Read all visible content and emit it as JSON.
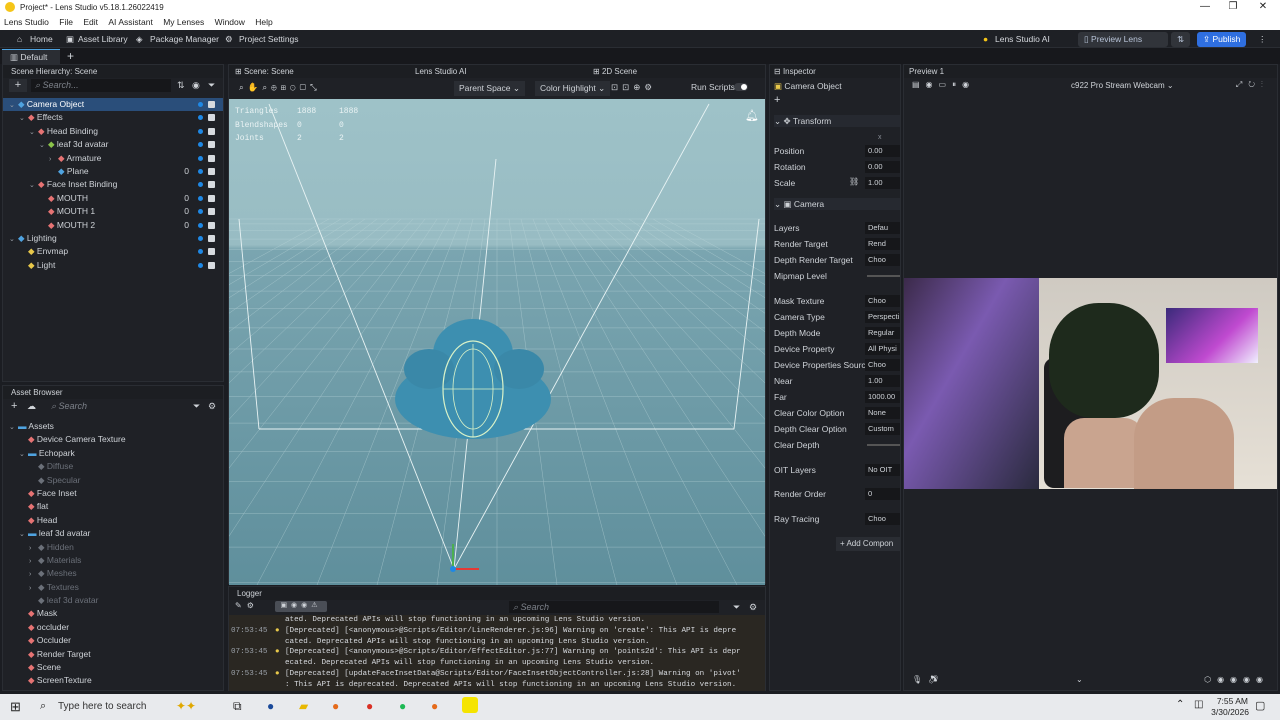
{
  "window": {
    "title": "Project* - Lens Studio v5.18.1.26022419",
    "min": "—",
    "max": "❐",
    "close": "✕"
  },
  "menu": [
    "Lens Studio",
    "File",
    "Edit",
    "AI Assistant",
    "My Lenses",
    "Window",
    "Help"
  ],
  "toolbar": {
    "home": "Home",
    "asset_library": "Asset Library",
    "package_manager": "Package Manager",
    "project_settings": "Project Settings",
    "lens_ai": "Lens Studio AI",
    "preview_lens": "Preview Lens",
    "publish": "Publish"
  },
  "tabs": {
    "default": "Default",
    "add": "+"
  },
  "hierarchy": {
    "title": "Scene Hierarchy: Scene",
    "search": "Search...",
    "items": [
      {
        "label": "Camera Object",
        "depth": 0,
        "arrow": "⌄",
        "selected": true
      },
      {
        "label": "Effects",
        "depth": 1,
        "arrow": "⌄"
      },
      {
        "label": "Head Binding",
        "depth": 2,
        "arrow": "⌄"
      },
      {
        "label": "leaf 3d avatar",
        "depth": 3,
        "arrow": "⌄"
      },
      {
        "label": "Armature",
        "depth": 4,
        "arrow": "›"
      },
      {
        "label": "Plane",
        "depth": 4,
        "arrow": "",
        "num": "0"
      },
      {
        "label": "Face Inset Binding",
        "depth": 2,
        "arrow": "⌄"
      },
      {
        "label": "MOUTH",
        "depth": 3,
        "arrow": "",
        "num": "0"
      },
      {
        "label": "MOUTH 1",
        "depth": 3,
        "arrow": "",
        "num": "0"
      },
      {
        "label": "MOUTH 2",
        "depth": 3,
        "arrow": "",
        "num": "0"
      },
      {
        "label": "Lighting",
        "depth": 0,
        "arrow": "⌄"
      },
      {
        "label": "Envmap",
        "depth": 1,
        "arrow": ""
      },
      {
        "label": "Light",
        "depth": 1,
        "arrow": ""
      }
    ]
  },
  "assets": {
    "title": "Asset Browser",
    "search": "Search",
    "items": [
      {
        "label": "Assets",
        "depth": 0,
        "arrow": "⌄"
      },
      {
        "label": "Device Camera Texture",
        "depth": 1,
        "arrow": ""
      },
      {
        "label": "Echopark",
        "depth": 1,
        "arrow": "⌄"
      },
      {
        "label": "Diffuse",
        "depth": 2,
        "arrow": "",
        "dim": true
      },
      {
        "label": "Specular",
        "depth": 2,
        "arrow": "",
        "dim": true
      },
      {
        "label": "Face Inset",
        "depth": 1,
        "arrow": ""
      },
      {
        "label": "flat",
        "depth": 1,
        "arrow": ""
      },
      {
        "label": "Head",
        "depth": 1,
        "arrow": ""
      },
      {
        "label": "leaf 3d avatar",
        "depth": 1,
        "arrow": "⌄"
      },
      {
        "label": "Hidden",
        "depth": 2,
        "arrow": "›",
        "dim": true
      },
      {
        "label": "Materials",
        "depth": 2,
        "arrow": "›",
        "dim": true
      },
      {
        "label": "Meshes",
        "depth": 2,
        "arrow": "›",
        "dim": true
      },
      {
        "label": "Textures",
        "depth": 2,
        "arrow": "›",
        "dim": true
      },
      {
        "label": "leaf 3d avatar",
        "depth": 2,
        "arrow": "",
        "dim": true
      },
      {
        "label": "Mask",
        "depth": 1,
        "arrow": ""
      },
      {
        "label": "occluder",
        "depth": 1,
        "arrow": ""
      },
      {
        "label": "Occluder",
        "depth": 1,
        "arrow": ""
      },
      {
        "label": "Render Target",
        "depth": 1,
        "arrow": ""
      },
      {
        "label": "Scene",
        "depth": 1,
        "arrow": ""
      },
      {
        "label": "ScreenTexture",
        "depth": 1,
        "arrow": ""
      }
    ]
  },
  "scene": {
    "tab1": "Scene: Scene",
    "tab2": "Lens Studio AI",
    "tab3": "2D Scene",
    "parent_space": "Parent Space",
    "color_highlight": "Color Highlight",
    "run_scripts": "Run Scripts",
    "stats": [
      [
        "Triangles",
        "1888",
        "1888"
      ],
      [
        "Blendshapes",
        "0",
        "0"
      ],
      [
        "Joints",
        "2",
        "2"
      ]
    ]
  },
  "logger": {
    "title": "Logger",
    "search": "Search",
    "lines": [
      [
        "",
        "ated. Deprecated APIs will stop functioning in an upcoming Lens Studio version."
      ],
      [
        "07:53:45",
        "[Deprecated] [<anonymous>@Scripts/Editor/LineRenderer.js:96] Warning on 'create': This API is depre"
      ],
      [
        "",
        "cated. Deprecated APIs will stop functioning in an upcoming Lens Studio version."
      ],
      [
        "07:53:45",
        "[Deprecated] [<anonymous>@Scripts/Editor/EffectEditor.js:77] Warning on 'points2d': This API is depr"
      ],
      [
        "",
        "ecated. Deprecated APIs will stop functioning in an upcoming Lens Studio version."
      ],
      [
        "07:53:45",
        "[Deprecated] [updateFaceInsetData@Scripts/Editor/FaceInsetObjectController.js:28] Warning on 'pivot'"
      ],
      [
        "",
        ": This API is deprecated. Deprecated APIs will stop functioning in an upcoming Lens Studio version."
      ]
    ]
  },
  "inspector": {
    "title": "Inspector",
    "object": "Camera Object",
    "transform": "Transform",
    "x": "x",
    "position": "Position",
    "position_v": "0.00",
    "rotation": "Rotation",
    "rotation_v": "0.00",
    "scale": "Scale",
    "scale_v": "1.00",
    "camera": "Camera",
    "rows": [
      [
        "Layers",
        "Defau"
      ],
      [
        "Render Target",
        "Rend"
      ],
      [
        "Depth Render Target",
        "Choo"
      ],
      [
        "Mipmap Level",
        ""
      ],
      [
        "Mask Texture",
        "Choo"
      ],
      [
        "Camera Type",
        "Perspecti"
      ],
      [
        "Depth Mode",
        "Regular"
      ],
      [
        "Device Property",
        "All Physi"
      ],
      [
        "Device Properties Source",
        "Choo"
      ],
      [
        "Near",
        "1.00"
      ],
      [
        "Far",
        "1000.00"
      ],
      [
        "Clear Color Option",
        "None"
      ],
      [
        "Depth Clear Option",
        "Custom"
      ],
      [
        "Clear Depth",
        ""
      ],
      [
        "OIT Layers",
        "No OIT"
      ],
      [
        "Render Order",
        "0"
      ],
      [
        "Ray Tracing",
        "Choo"
      ]
    ],
    "add_component": "Add Compon"
  },
  "preview": {
    "title": "Preview 1",
    "camera": "c922 Pro Stream Webcam"
  },
  "taskbar": {
    "search": "Type here to search",
    "time": "7:55 AM",
    "date": "3/30/2026"
  }
}
